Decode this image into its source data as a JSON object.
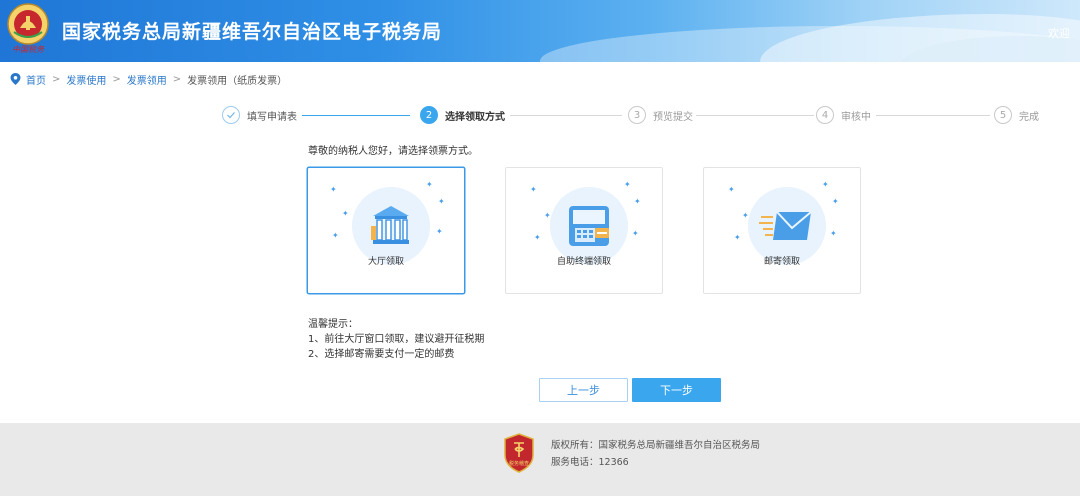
{
  "header": {
    "logo_caption": "中国税务",
    "title": "国家税务总局新疆维吾尔自治区电子税务局",
    "welcome": "欢迎"
  },
  "breadcrumb": {
    "items": [
      "首页",
      "发票使用",
      "发票领用"
    ],
    "current": "发票领用（纸质发票）"
  },
  "steps": [
    {
      "number": "✓",
      "label": "填写申请表",
      "state": "done"
    },
    {
      "number": "2",
      "label": "选择领取方式",
      "state": "active"
    },
    {
      "number": "3",
      "label": "预览提交",
      "state": "todo"
    },
    {
      "number": "4",
      "label": "审核中",
      "state": "todo"
    },
    {
      "number": "5",
      "label": "完成",
      "state": "todo"
    }
  ],
  "prompt": "尊敬的纳税人您好，请选择领票方式。",
  "options": [
    {
      "label": "大厅领取",
      "icon": "government-building-icon",
      "selected": true
    },
    {
      "label": "自助终端领取",
      "icon": "self-service-terminal-icon",
      "selected": false
    },
    {
      "label": "邮寄领取",
      "icon": "mail-envelope-icon",
      "selected": false
    }
  ],
  "tips": {
    "title": "温馨提示：",
    "lines": [
      "1、前往大厅窗口领取，建议避开征税期",
      "2、选择邮寄需要支付一定的邮费"
    ]
  },
  "buttons": {
    "prev": "上一步",
    "next": "下一步"
  },
  "footer": {
    "emblem_text": "税务稽查",
    "copyright": "版权所有：国家税务总局新疆维吾尔自治区税务局",
    "phone": "服务电话：12366"
  },
  "colors": {
    "accent": "#3aa6ee",
    "link": "#2a77c9",
    "header_start": "#1f76d6",
    "footer_bg": "#e9e9e9"
  }
}
